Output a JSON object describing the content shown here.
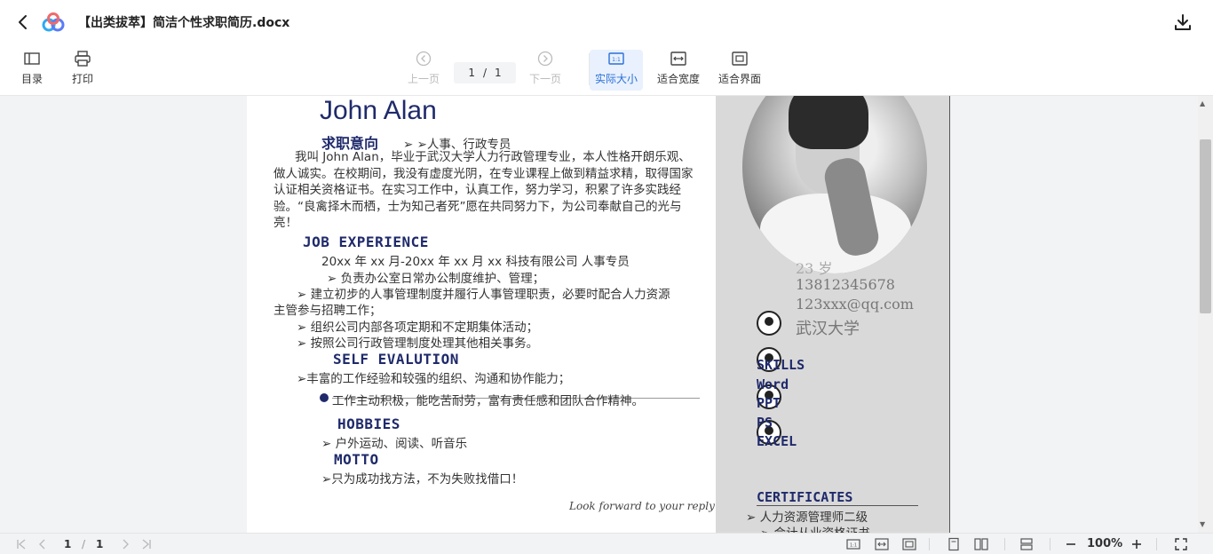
{
  "header": {
    "title": "【出类拔萃】简洁个性求职简历.docx"
  },
  "toolbar": {
    "toc": "目录",
    "print": "打印",
    "prev_page": "上一页",
    "current_page": "1",
    "page_sep": "/",
    "total_pages": "1",
    "next_page": "下一页",
    "actual_size": "实际大小",
    "fit_width": "适合宽度",
    "fit_page": "适合界面"
  },
  "document": {
    "name": "John Alan",
    "intent_heading": "求职意向",
    "intent_value": "➢ ➢人事、行政专员",
    "intro": "我叫 John Alan，毕业于武汉大学人力行政管理专业，本人性格开朗乐观、做人诚实。在校期间，我没有虚度光阴，在专业课程上做到精益求精，取得国家认证相关资格证书。在实习工作中，认真工作，努力学习，积累了许多实践经验。“良禽择木而栖，士为知己者死”愿在共同努力下，为公司奉献自己的光与亮！",
    "job_heading": "JOB  EXPERIENCE",
    "job_period": "20xx 年 xx 月-20xx 年 xx 月     xx 科技有限公司  人事专员",
    "job_item1": "➢ 负责办公室日常办公制度维护、管理；",
    "job_item2": "➢ 建立初步的人事管理制度并履行人事管理职责，必要时配合人力资源",
    "job_item2_cont": "主管参与招聘工作；",
    "job_item3": "➢ 组织公司内部各项定期和不定期集体活动；",
    "job_item4": "➢ 按照公司行政管理制度处理其他相关事务。",
    "self_heading": "SELF EVALUTION",
    "self_item1": "➢丰富的工作经验和较强的组织、沟通和协作能力；",
    "self_item2": "工作主动积极，能吃苦耐劳，富有责任感和团队合作精神。",
    "hobbies_heading": "HOBBIES",
    "hobbies_item": "➢  户外运动、阅读、听音乐",
    "motto_heading": "MOTTO",
    "motto_item": "➢只为成功找方法，不为失败找借口！",
    "signature": "Look forward to your reply",
    "age": "23 岁",
    "phone": "13812345678",
    "email": "123xxx@qq.com",
    "school": "武汉大学",
    "skills_heading": "SKILLS",
    "skill1": "Word",
    "skill2": "PPT",
    "skill3": "PS",
    "skill4": "EXCEL",
    "cert_heading": "CERTIFICATES",
    "cert1": "➢ 人力资源管理师二级",
    "cert2": "➢ 会计从业资格证书"
  },
  "statusbar": {
    "current_page": "1",
    "page_sep": "/",
    "total_pages": "1",
    "zoom": "100%"
  },
  "colors": {
    "accent": "#2b6fd6",
    "heading": "#1f2a6b",
    "sidebar_bg": "#d9d9d9"
  }
}
